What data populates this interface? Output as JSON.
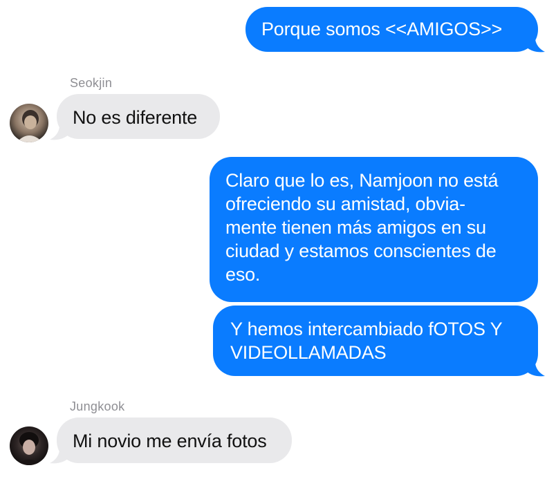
{
  "colors": {
    "outgoing_bubble": "#0a7cff",
    "incoming_bubble": "#e9e9eb",
    "sender_label": "#8e8e93"
  },
  "messages": [
    {
      "direction": "outgoing",
      "text": "Porque somos <<AMIGOS>>"
    },
    {
      "direction": "incoming",
      "sender": "Seokjin",
      "text": "No es diferente"
    },
    {
      "direction": "outgoing",
      "lines": [
        "Claro que lo es, Namjoon no está",
        "ofreciendo su amistad, obvia-",
        "mente tienen más amigos en su",
        "ciudad y estamos conscientes de",
        "eso."
      ]
    },
    {
      "direction": "outgoing",
      "lines": [
        "Y hemos intercambiado fOTOS Y",
        "VIDEOLLAMADAS"
      ]
    },
    {
      "direction": "incoming",
      "sender": "Jungkook",
      "text": "Mi novio me envía fotos"
    }
  ]
}
